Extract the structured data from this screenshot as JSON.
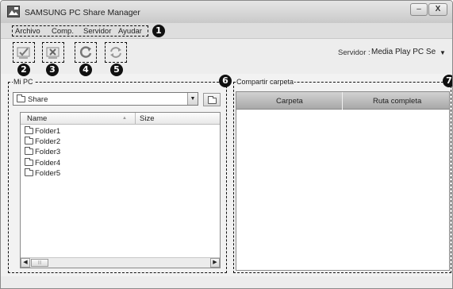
{
  "window": {
    "title": "SAMSUNG PC Share Manager",
    "minimize_glyph": "–",
    "close_glyph": "X"
  },
  "menu": {
    "items": [
      "Archivo",
      "Comp.",
      "Servidor",
      "Ayudar"
    ]
  },
  "toolbar": {
    "buttons": [
      {
        "icon": "share-check-icon"
      },
      {
        "icon": "unshare-x-icon"
      },
      {
        "icon": "refresh-icon"
      },
      {
        "icon": "sync-state-icon"
      }
    ],
    "server_label": "Servidor :",
    "server_value": "Media Play PC Se",
    "server_arrow": "▼"
  },
  "badges": [
    "1",
    "2",
    "3",
    "4",
    "5",
    "6",
    "7"
  ],
  "left_panel": {
    "title": "Mi PC",
    "folder_select": "Share",
    "combo_arrow": "▼",
    "columns": [
      "Name",
      "Size"
    ],
    "sort_indicator": "▲",
    "folders": [
      "Folder1",
      "Folder2",
      "Folder3",
      "Folder4",
      "Folder5"
    ],
    "scroll_left": "◀",
    "scroll_right": "▶",
    "scroll_grip": "|||"
  },
  "right_panel": {
    "title": "Compartir carpeta",
    "columns": [
      "Carpeta",
      "Ruta completa"
    ]
  },
  "colors": {
    "window_bg": "#f2f2f2",
    "titlebar": "#d8d8d8",
    "table_header": "#b8b8b8",
    "badge": "#111111"
  }
}
